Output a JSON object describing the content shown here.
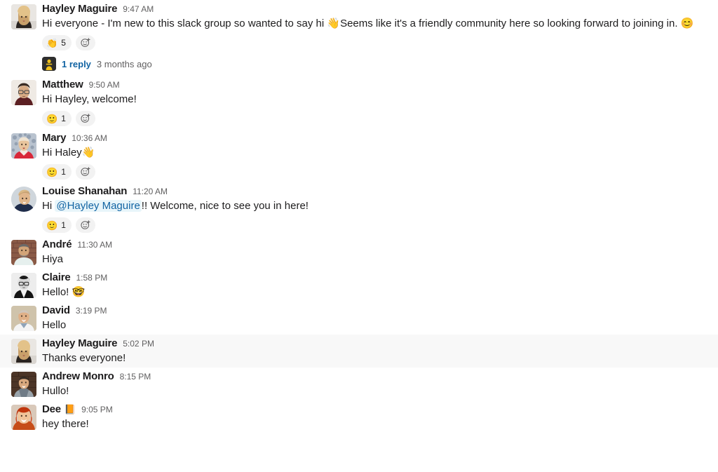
{
  "channel": {
    "messages": [
      {
        "author": "Hayley Maguire",
        "time": "9:47 AM",
        "text_before_mention": "Hi everyone - I'm new to this slack group so wanted to say hi ",
        "emoji_inline": "👋",
        "text_after": "Seems like it's a friendly community here so looking forward to joining in. ",
        "emoji_end": "😊",
        "avatar": "hayley",
        "avatar_shape": "square",
        "hovered": false,
        "reaction": {
          "emoji": "👏",
          "count": "5"
        },
        "thread": {
          "count_label": "1 reply",
          "time_label": "3 months ago"
        }
      },
      {
        "author": "Matthew",
        "time": "9:50 AM",
        "text": "Hi Hayley, welcome!",
        "avatar": "matthew",
        "avatar_shape": "square",
        "hovered": false,
        "reaction": {
          "emoji": "🙂",
          "count": "1"
        }
      },
      {
        "author": "Mary",
        "time": "10:36 AM",
        "text": "Hi Haley",
        "emoji_end": "👋",
        "avatar": "mary",
        "avatar_shape": "square",
        "hovered": false,
        "reaction": {
          "emoji": "🙂",
          "count": "1"
        }
      },
      {
        "author": "Louise Shanahan",
        "time": "11:20 AM",
        "text_before_mention": "Hi ",
        "mention": "@Hayley Maguire",
        "text_after": "!! Welcome, nice to see you in here!",
        "avatar": "louise",
        "avatar_shape": "round",
        "hovered": false,
        "reaction": {
          "emoji": "🙂",
          "count": "1"
        }
      },
      {
        "author": "André",
        "time": "11:30 AM",
        "text": "Hiya",
        "avatar": "andre",
        "avatar_shape": "square",
        "hovered": false
      },
      {
        "author": "Claire",
        "time": "1:58 PM",
        "text": "Hello! ",
        "emoji_end": "🤓",
        "avatar": "claire",
        "avatar_shape": "square",
        "hovered": false
      },
      {
        "author": "David",
        "time": "3:19 PM",
        "text": "Hello",
        "avatar": "david",
        "avatar_shape": "square",
        "hovered": false
      },
      {
        "author": "Hayley Maguire",
        "time": "5:02 PM",
        "text": "Thanks everyone!",
        "avatar": "hayley",
        "avatar_shape": "square",
        "hovered": true
      },
      {
        "author": "Andrew Monro",
        "time": "8:15 PM",
        "text": "Hullo!",
        "avatar": "andrew",
        "avatar_shape": "square",
        "hovered": false
      },
      {
        "author": "Dee",
        "status_emoji": "📙",
        "time": "9:05 PM",
        "text": "hey there!",
        "avatar": "dee",
        "avatar_shape": "square",
        "hovered": false
      }
    ]
  },
  "colors": {
    "text": "#1d1c1d",
    "timestamp": "#616061",
    "link": "#1264a3",
    "mention_bg": "#e8f5fa",
    "reaction_bg": "#f2f2f2",
    "hover_bg": "#f8f8f8"
  },
  "icons": {
    "add_reaction": "add-reaction-icon",
    "thread_avatar": "thread-participant-avatar"
  }
}
